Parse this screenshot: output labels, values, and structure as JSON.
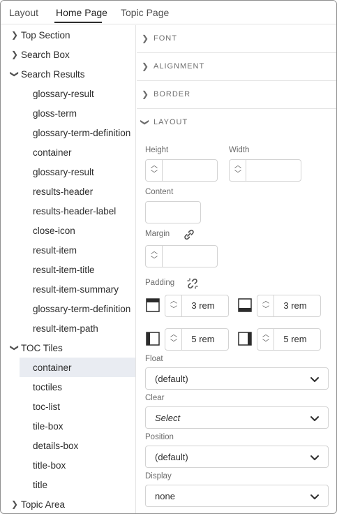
{
  "tabs": [
    {
      "label": "Layout"
    },
    {
      "label": "Home Page"
    },
    {
      "label": "Topic Page"
    }
  ],
  "active_tab": "Home Page",
  "tree": {
    "items": [
      {
        "label": "Top Section",
        "level": 0,
        "expanded": false
      },
      {
        "label": "Search Box",
        "level": 0,
        "expanded": false
      },
      {
        "label": "Search Results",
        "level": 0,
        "expanded": true
      },
      {
        "label": "glossary-result",
        "level": 1
      },
      {
        "label": "gloss-term",
        "level": 1
      },
      {
        "label": "glossary-term-definition",
        "level": 1
      },
      {
        "label": "container",
        "level": 1
      },
      {
        "label": "glossary-result",
        "level": 1
      },
      {
        "label": "results-header",
        "level": 1
      },
      {
        "label": "results-header-label",
        "level": 1
      },
      {
        "label": "close-icon",
        "level": 1
      },
      {
        "label": "result-item",
        "level": 1
      },
      {
        "label": "result-item-title",
        "level": 1
      },
      {
        "label": "result-item-summary",
        "level": 1
      },
      {
        "label": "glossary-term-definition",
        "level": 1
      },
      {
        "label": "result-item-path",
        "level": 1
      },
      {
        "label": "TOC Tiles",
        "level": 0,
        "expanded": true
      },
      {
        "label": "container",
        "level": 1,
        "selected": true
      },
      {
        "label": "toctiles",
        "level": 1
      },
      {
        "label": "toc-list",
        "level": 1
      },
      {
        "label": "tile-box",
        "level": 1
      },
      {
        "label": "details-box",
        "level": 1
      },
      {
        "label": "title-box",
        "level": 1
      },
      {
        "label": "title",
        "level": 1
      },
      {
        "label": "Topic Area",
        "level": 0,
        "expanded": false
      }
    ]
  },
  "panel": {
    "sections": [
      {
        "label": "FONT",
        "expanded": false
      },
      {
        "label": "ALIGNMENT",
        "expanded": false
      },
      {
        "label": "BORDER",
        "expanded": false
      },
      {
        "label": "LAYOUT",
        "expanded": true
      }
    ],
    "layout": {
      "height_label": "Height",
      "height_value": "",
      "width_label": "Width",
      "width_value": "",
      "content_label": "Content",
      "content_value": "",
      "margin_label": "Margin",
      "margin_value": "",
      "margin_link_icon": "link-icon",
      "padding_label": "Padding",
      "padding_link_icon": "unlink-icon",
      "padding_top": "3 rem",
      "padding_bottom": "3 rem",
      "padding_left": "5 rem",
      "padding_right": "5 rem",
      "float_label": "Float",
      "float_value": "(default)",
      "clear_label": "Clear",
      "clear_value": "Select",
      "position_label": "Position",
      "position_value": "(default)",
      "display_label": "Display",
      "display_value": "none"
    }
  },
  "colors": {
    "selected_row": "#e9ecf2",
    "border": "#d3d3d3",
    "text": "#2c2c2c",
    "muted": "#6e6e6e"
  }
}
